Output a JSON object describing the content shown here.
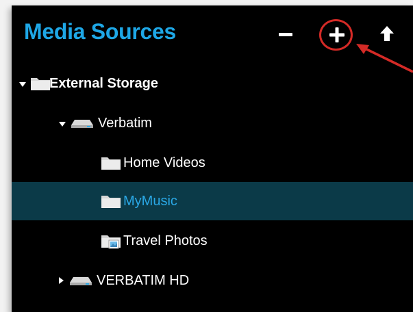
{
  "header": {
    "title": "Media Sources",
    "buttons": [
      {
        "name": "remove",
        "icon": "minus-icon"
      },
      {
        "name": "add",
        "icon": "plus-icon",
        "annotated": true
      },
      {
        "name": "up",
        "icon": "arrow-up-icon"
      }
    ]
  },
  "colors": {
    "accent": "#1ea7e6",
    "selected_bg": "#0b3a48",
    "annotation": "#d42a26"
  },
  "tree": {
    "items": [
      {
        "label": "External Storage",
        "icon": "folder-icon",
        "expanded": true,
        "level": 0,
        "bold": true
      },
      {
        "label": "Verbatim",
        "icon": "drive-icon",
        "expanded": true,
        "level": 1
      },
      {
        "label": "Home Videos",
        "icon": "folder-icon",
        "level": 2
      },
      {
        "label": "MyMusic",
        "icon": "folder-icon",
        "level": 2,
        "selected": true
      },
      {
        "label": "Travel Photos",
        "icon": "photo-folder-icon",
        "level": 2
      },
      {
        "label": "VERBATIM HD",
        "icon": "drive-icon",
        "expanded": false,
        "level": 1
      }
    ]
  }
}
